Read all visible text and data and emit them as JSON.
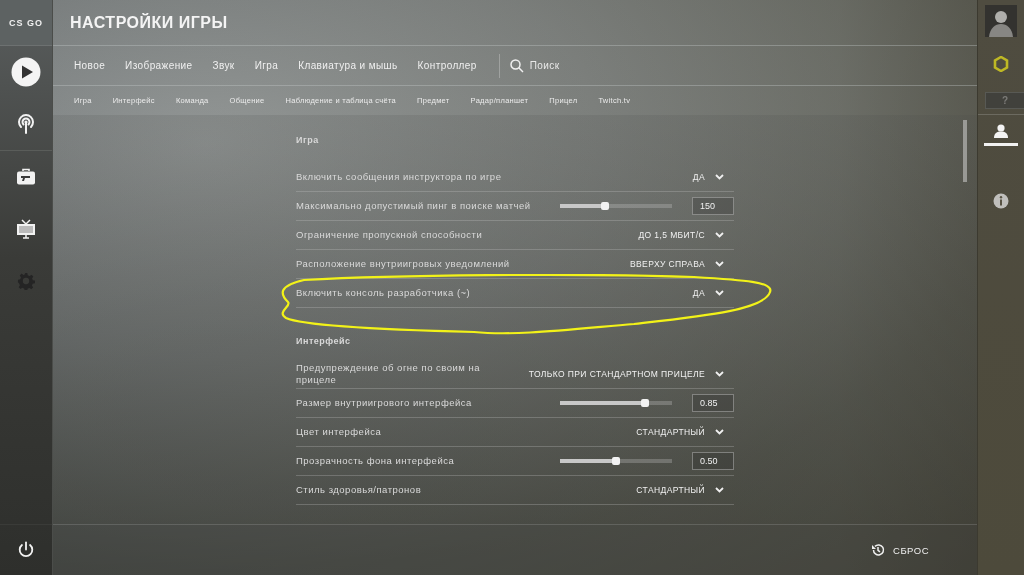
{
  "logo": {
    "text": "CS GO"
  },
  "left_nav": [
    {
      "kind": "play",
      "selected": false
    },
    {
      "kind": "antenna",
      "selected": false
    },
    {
      "kind": "briefcase",
      "selected": false
    },
    {
      "kind": "tv",
      "selected": false
    },
    {
      "kind": "gear",
      "selected": true
    }
  ],
  "window": {
    "title": "НАСТРОЙКИ ИГРЫ"
  },
  "tabs": [
    {
      "label": "Новое"
    },
    {
      "label": "Изображение"
    },
    {
      "label": "Звук"
    },
    {
      "label": "Игра"
    },
    {
      "label": "Клавиатура и мышь"
    },
    {
      "label": "Контроллер"
    }
  ],
  "search": {
    "label": "Поиск"
  },
  "subtabs": [
    {
      "label": "Игра"
    },
    {
      "label": "Интерфейс"
    },
    {
      "label": "Команда"
    },
    {
      "label": "Общение"
    },
    {
      "label": "Наблюдение и таблица счёта"
    },
    {
      "label": "Предмет"
    },
    {
      "label": "Радар/планшет"
    },
    {
      "label": "Прицел"
    },
    {
      "label": "Twitch.tv"
    }
  ],
  "sections": [
    {
      "title": "Игра",
      "rows": [
        {
          "kind": "dropdown",
          "label": "Включить сообщения инструктора по игре",
          "value": "ДА",
          "circled": false
        },
        {
          "kind": "slider",
          "label": "Максимально допустимый пинг в поиске матчей",
          "level": 0.4,
          "value": "150",
          "circled": false
        },
        {
          "kind": "dropdown",
          "label": "Ограничение пропускной способности",
          "value": "ДО 1,5 МБИТ/С",
          "circled": false
        },
        {
          "kind": "dropdown",
          "label": "Расположение внутриигровых уведомлений",
          "value": "ВВЕРХУ СПРАВА",
          "circled": false
        },
        {
          "kind": "dropdown",
          "label": "Включить консоль разработчика (~)",
          "value": "ДА",
          "circled": true
        }
      ]
    },
    {
      "title": "Интерфейс",
      "rows": [
        {
          "kind": "dropdown",
          "label": "Предупреждение об огне по своим на прицеле",
          "value": "ТОЛЬКО ПРИ СТАНДАРТНОМ ПРИЦЕЛЕ",
          "circled": false
        },
        {
          "kind": "slider",
          "label": "Размер внутриигрового интерфейса",
          "level": 0.76,
          "value": "0.85",
          "circled": false
        },
        {
          "kind": "dropdown",
          "label": "Цвет интерфейса",
          "value": "СТАНДАРТНЫЙ",
          "circled": false
        },
        {
          "kind": "slider",
          "label": "Прозрачность фона интерфейса",
          "level": 0.5,
          "value": "0.50",
          "circled": false
        },
        {
          "kind": "dropdown",
          "label": "Стиль здоровья/патронов",
          "value": "СТАНДАРТНЫЙ",
          "circled": false
        }
      ]
    }
  ],
  "reset_button": {
    "label": "СБРОС"
  },
  "right_nav": [
    {
      "kind": "avatar",
      "selected": false
    },
    {
      "kind": "medal",
      "selected": false
    },
    {
      "kind": "rank",
      "label": "?",
      "selected": false
    },
    {
      "kind": "person",
      "selected": true
    },
    {
      "kind": "info",
      "selected": false
    }
  ]
}
